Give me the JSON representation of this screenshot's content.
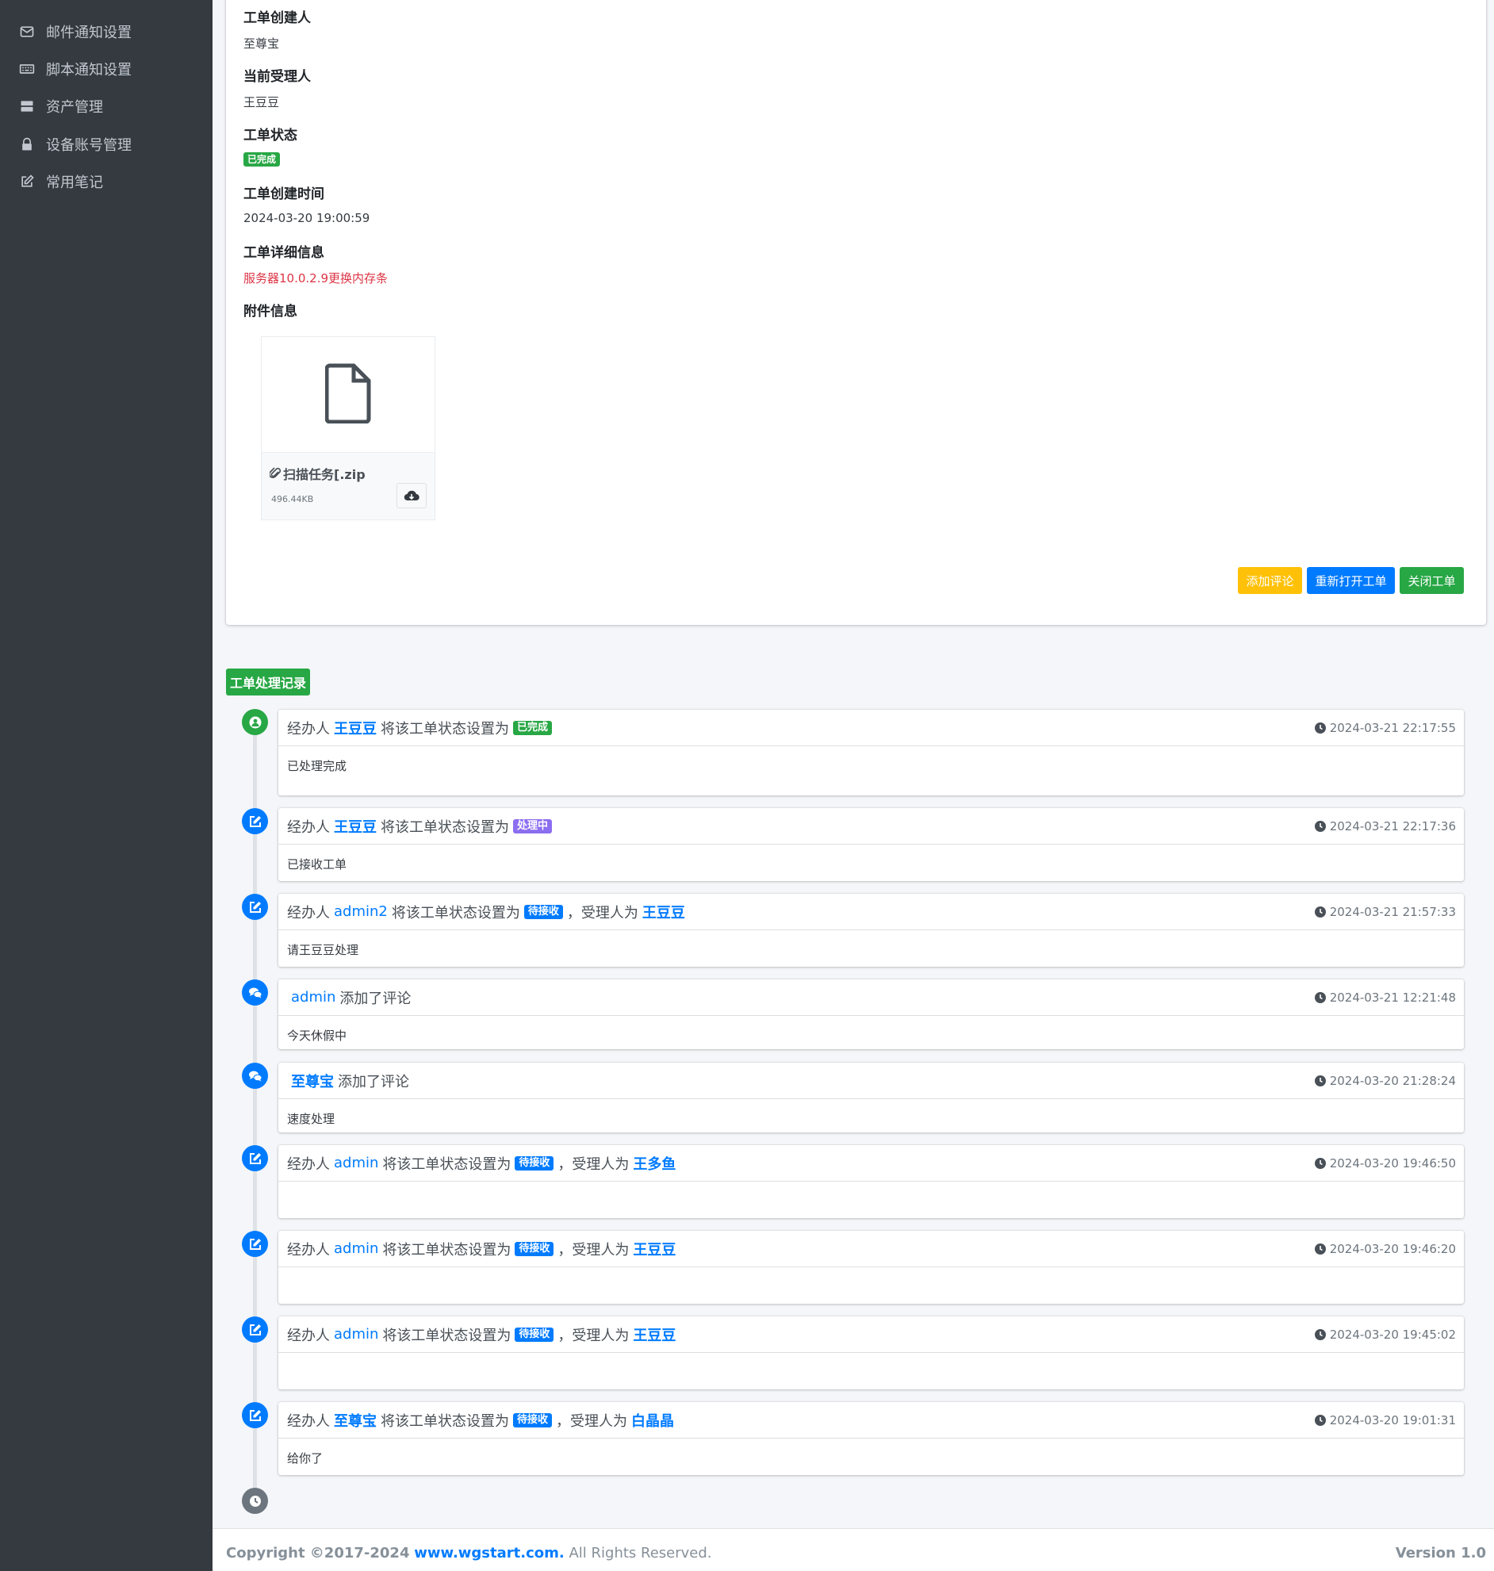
{
  "sidebar": {
    "items": [
      {
        "label": "邮件通知设置",
        "icon": "envelope-icon"
      },
      {
        "label": "脚本通知设置",
        "icon": "keyboard-icon"
      },
      {
        "label": "资产管理",
        "icon": "server-icon"
      },
      {
        "label": "设备账号管理",
        "icon": "lock-icon"
      },
      {
        "label": "常用笔记",
        "icon": "edit-icon"
      }
    ]
  },
  "ticket": {
    "creator_label": "工单创建人",
    "creator": "至尊宝",
    "assignee_label": "当前受理人",
    "assignee": "王豆豆",
    "status_label": "工单状态",
    "status": "已完成",
    "created_label": "工单创建时间",
    "created": "2024-03-20 19:00:59",
    "detail_label": "工单详细信息",
    "detail": "服务器10.0.2.9更换内存条",
    "attachment_label": "附件信息",
    "attachment": {
      "name": "扫描任务[.zip",
      "size": "496.44KB"
    },
    "buttons": {
      "comment": "添加评论",
      "reopen": "重新打开工单",
      "close": "关闭工单"
    }
  },
  "timeline": {
    "title": "工单处理记录",
    "entries": [
      {
        "type": "status",
        "prefix": "经办人",
        "user": "王豆豆",
        "user_bold": true,
        "action": "将该工单状态设置为",
        "status": "已完成",
        "status_color": "#28a745",
        "assignee_prefix": "",
        "assignee": "",
        "time": "2024-03-21 22:17:55",
        "body": "已处理完成",
        "icon": "user-icon",
        "icon_color": "#28a745"
      },
      {
        "type": "status",
        "prefix": "经办人",
        "user": "王豆豆",
        "user_bold": true,
        "action": "将该工单状态设置为",
        "status": "处理中",
        "status_color": "#8c6ef0",
        "assignee_prefix": "",
        "assignee": "",
        "time": "2024-03-21 22:17:36",
        "body": "已接收工单",
        "icon": "edit-icon",
        "icon_color": "#007bff"
      },
      {
        "type": "status",
        "prefix": "经办人",
        "user": "admin2",
        "user_bold": false,
        "action": "将该工单状态设置为",
        "status": "待接收",
        "status_color": "#007bff",
        "assignee_prefix": "，受理人为",
        "assignee": "王豆豆",
        "time": "2024-03-21 21:57:33",
        "body": "请王豆豆处理",
        "icon": "edit-icon",
        "icon_color": "#007bff"
      },
      {
        "type": "comment",
        "prefix": "",
        "user": "admin",
        "user_bold": false,
        "action": "添加了评论",
        "status": "",
        "assignee_prefix": "",
        "assignee": "",
        "time": "2024-03-21 12:21:48",
        "body": "今天休假中",
        "icon": "comments-icon",
        "icon_color": "#007bff"
      },
      {
        "type": "comment",
        "prefix": "",
        "user": "至尊宝",
        "user_bold": true,
        "action": "添加了评论",
        "status": "",
        "assignee_prefix": "",
        "assignee": "",
        "time": "2024-03-20 21:28:24",
        "body": "速度处理",
        "icon": "comments-icon",
        "icon_color": "#007bff"
      },
      {
        "type": "status",
        "prefix": "经办人",
        "user": "admin",
        "user_bold": false,
        "action": "将该工单状态设置为",
        "status": "待接收",
        "status_color": "#007bff",
        "assignee_prefix": "，受理人为",
        "assignee": "王多鱼",
        "time": "2024-03-20 19:46:50",
        "body": "",
        "icon": "edit-icon",
        "icon_color": "#007bff"
      },
      {
        "type": "status",
        "prefix": "经办人",
        "user": "admin",
        "user_bold": false,
        "action": "将该工单状态设置为",
        "status": "待接收",
        "status_color": "#007bff",
        "assignee_prefix": "，受理人为",
        "assignee": "王豆豆",
        "time": "2024-03-20 19:46:20",
        "body": "",
        "icon": "edit-icon",
        "icon_color": "#007bff"
      },
      {
        "type": "status",
        "prefix": "经办人",
        "user": "admin",
        "user_bold": false,
        "action": "将该工单状态设置为",
        "status": "待接收",
        "status_color": "#007bff",
        "assignee_prefix": "，受理人为",
        "assignee": "王豆豆",
        "time": "2024-03-20 19:45:02",
        "body": "",
        "icon": "edit-icon",
        "icon_color": "#007bff"
      },
      {
        "type": "status",
        "prefix": "经办人",
        "user": "至尊宝",
        "user_bold": true,
        "action": "将该工单状态设置为",
        "status": "待接收",
        "status_color": "#007bff",
        "assignee_prefix": "，受理人为",
        "assignee": "白晶晶",
        "time": "2024-03-20 19:01:31",
        "body": "给你了",
        "icon": "edit-icon",
        "icon_color": "#007bff"
      }
    ]
  },
  "footer": {
    "copyright": "Copyright ©2017-2024",
    "link": "www.wgstart.com.",
    "rights": "All Rights Reserved.",
    "version": "Version 1.0"
  }
}
